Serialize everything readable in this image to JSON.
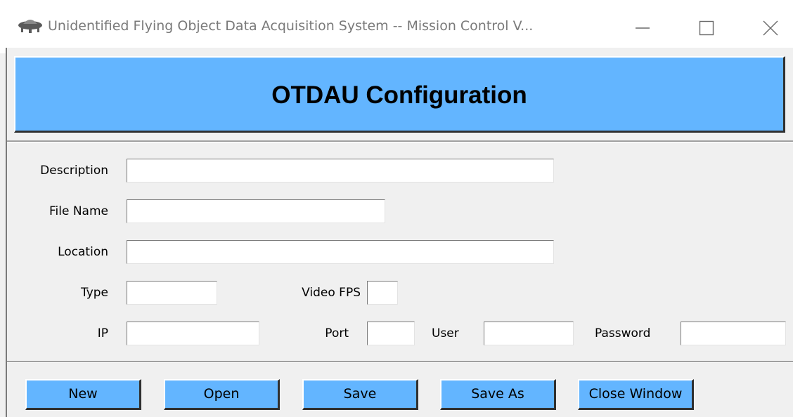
{
  "window": {
    "title": "Unidentified Flying Object Data Acquisition System -- Mission Control   V...",
    "app_icon": "flying-saucer-icon",
    "controls": [
      "minimize-icon",
      "maximize-icon",
      "close-icon"
    ]
  },
  "banner": {
    "title": "OTDAU Configuration",
    "color": "#63b5ff"
  },
  "form": {
    "description_label": "Description",
    "file_name_label": "File Name",
    "location_label": "Location",
    "type_label": "Type",
    "video_fps_label": "Video FPS",
    "ip_label": "IP",
    "port_label": "Port",
    "user_label": "User",
    "password_label": "Password",
    "description_value": "",
    "file_name_value": "",
    "location_value": "",
    "type_value": "",
    "video_fps_value": "",
    "ip_value": "",
    "port_value": "",
    "user_value": "",
    "password_value": ""
  },
  "buttons": {
    "new": "New",
    "open": "Open",
    "save": "Save",
    "save_as": "Save As",
    "close_window": "Close Window"
  }
}
